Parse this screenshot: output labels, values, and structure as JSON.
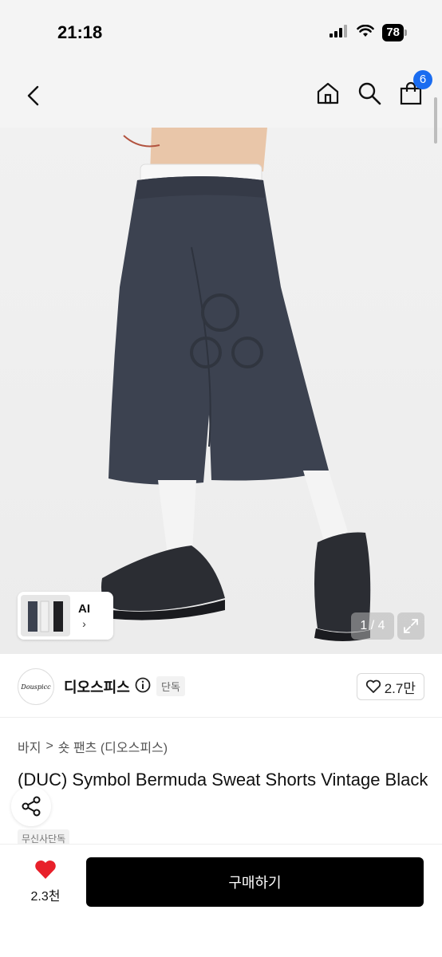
{
  "status_bar": {
    "time": "21:18",
    "battery": "78"
  },
  "nav": {
    "cart_count": "6"
  },
  "gallery": {
    "ai_label": "AI",
    "ai_chevron": "›",
    "page_indicator": "1 / 4"
  },
  "brand": {
    "logo_text": "Douspicc",
    "name": "디오스피스",
    "exclusive_tag": "단독",
    "likes": "2.7만"
  },
  "breadcrumb": {
    "category": "바지",
    "separator": ">",
    "subcategory": "숏 팬츠 (디오스피스)"
  },
  "product": {
    "title": "(DUC) Symbol Bermuda Sweat Shorts Vintage Black",
    "exclusive_badge": "무신사단독"
  },
  "bottom_bar": {
    "wish_count": "2.3천",
    "buy_label": "구매하기"
  },
  "colors": {
    "accent_blue": "#1a6cf0",
    "heart_red": "#e8202a",
    "shorts": "#3c4250",
    "buy_button": "#000000"
  },
  "icons": [
    "back-icon",
    "home-icon",
    "search-icon",
    "bag-icon",
    "expand-icon",
    "info-icon",
    "heart-icon",
    "share-icon"
  ]
}
